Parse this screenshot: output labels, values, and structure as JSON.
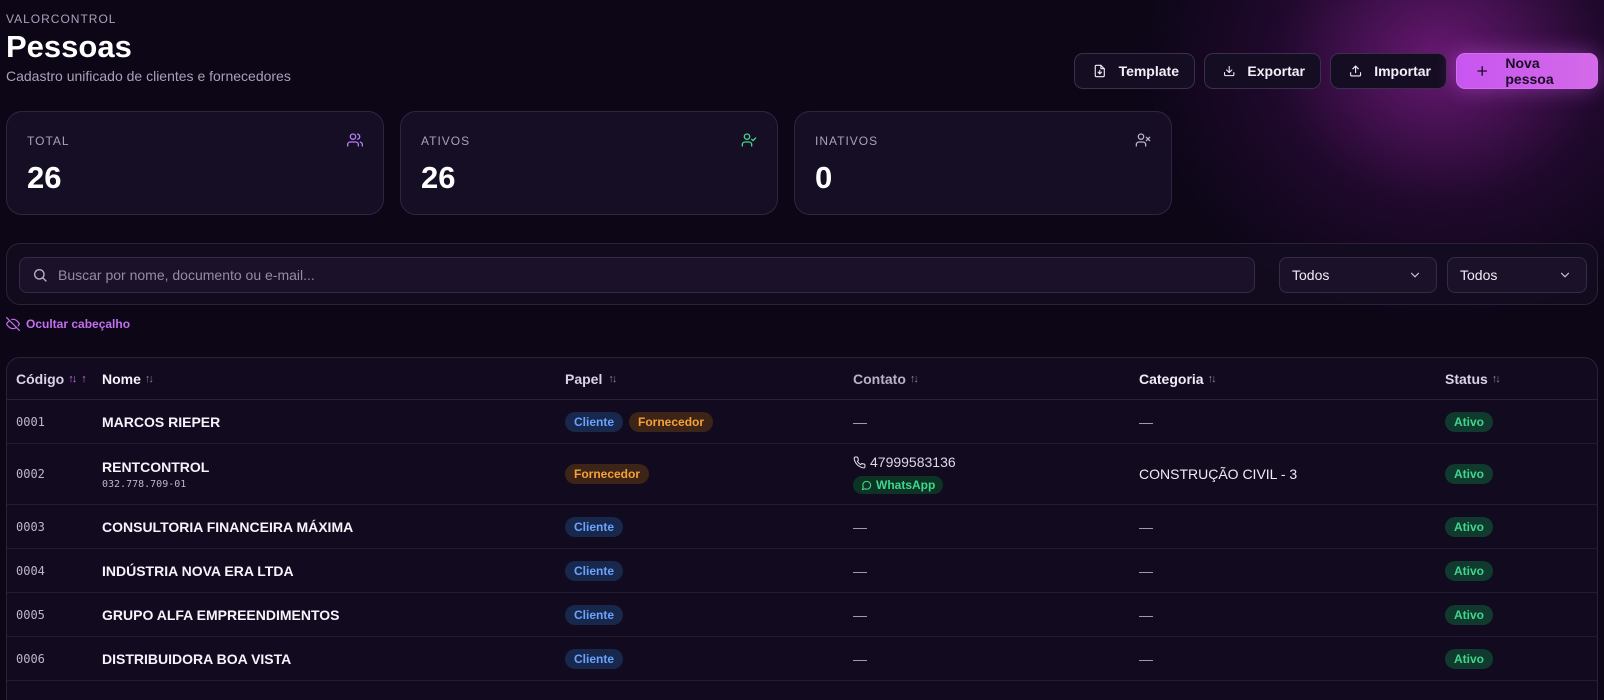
{
  "header": {
    "eyebrow": "VALORCONTROL",
    "title": "Pessoas",
    "subtitle": "Cadastro unificado de clientes e fornecedores"
  },
  "actions": {
    "template_label": "Template",
    "export_label": "Exportar",
    "import_label": "Importar",
    "new_label": "Nova pessoa"
  },
  "stats": [
    {
      "label": "TOTAL",
      "value": "26",
      "icon": "users-icon",
      "color": "#b57ef5"
    },
    {
      "label": "ATIVOS",
      "value": "26",
      "icon": "user-check-icon",
      "color": "#3fd68d"
    },
    {
      "label": "INATIVOS",
      "value": "0",
      "icon": "user-x-icon",
      "color": "#b9b2c8"
    }
  ],
  "filters": {
    "search_placeholder": "Buscar por nome, documento ou e-mail...",
    "role_select": "Todos",
    "status_select": "Todos"
  },
  "toggle_header_label": "Ocultar cabeçalho",
  "table": {
    "columns": [
      "Código",
      "Nome",
      "Papel",
      "Contato",
      "Categoria",
      "Status"
    ],
    "sort_glyph": "↑↓",
    "sort_active_arrow": "↑",
    "rows": [
      {
        "code": "0001",
        "name": "MARCOS RIEPER",
        "doc": "",
        "roles": [
          "Cliente",
          "Fornecedor"
        ],
        "contact": "—",
        "category": "—",
        "status": "Ativo"
      },
      {
        "code": "0002",
        "name": "RENTCONTROL",
        "doc": "032.778.709-01",
        "roles": [
          "Fornecedor"
        ],
        "phone": "47999583136",
        "whatsapp": "WhatsApp",
        "category": "CONSTRUÇÃO CIVIL - 3",
        "status": "Ativo"
      },
      {
        "code": "0003",
        "name": "CONSULTORIA FINANCEIRA MÁXIMA",
        "doc": "",
        "roles": [
          "Cliente"
        ],
        "contact": "—",
        "category": "—",
        "status": "Ativo"
      },
      {
        "code": "0004",
        "name": "INDÚSTRIA NOVA ERA LTDA",
        "doc": "",
        "roles": [
          "Cliente"
        ],
        "contact": "—",
        "category": "—",
        "status": "Ativo"
      },
      {
        "code": "0005",
        "name": "GRUPO ALFA EMPREENDIMENTOS",
        "doc": "",
        "roles": [
          "Cliente"
        ],
        "contact": "—",
        "category": "—",
        "status": "Ativo"
      },
      {
        "code": "0006",
        "name": "DISTRIBUIDORA BOA VISTA",
        "doc": "",
        "roles": [
          "Cliente"
        ],
        "contact": "—",
        "category": "—",
        "status": "Ativo"
      }
    ]
  },
  "colors": {
    "accent": "#c855f0",
    "background": "#0c0617",
    "cliente": "#6aa2ff",
    "fornecedor": "#f6a233",
    "ativo": "#3fd68d"
  }
}
